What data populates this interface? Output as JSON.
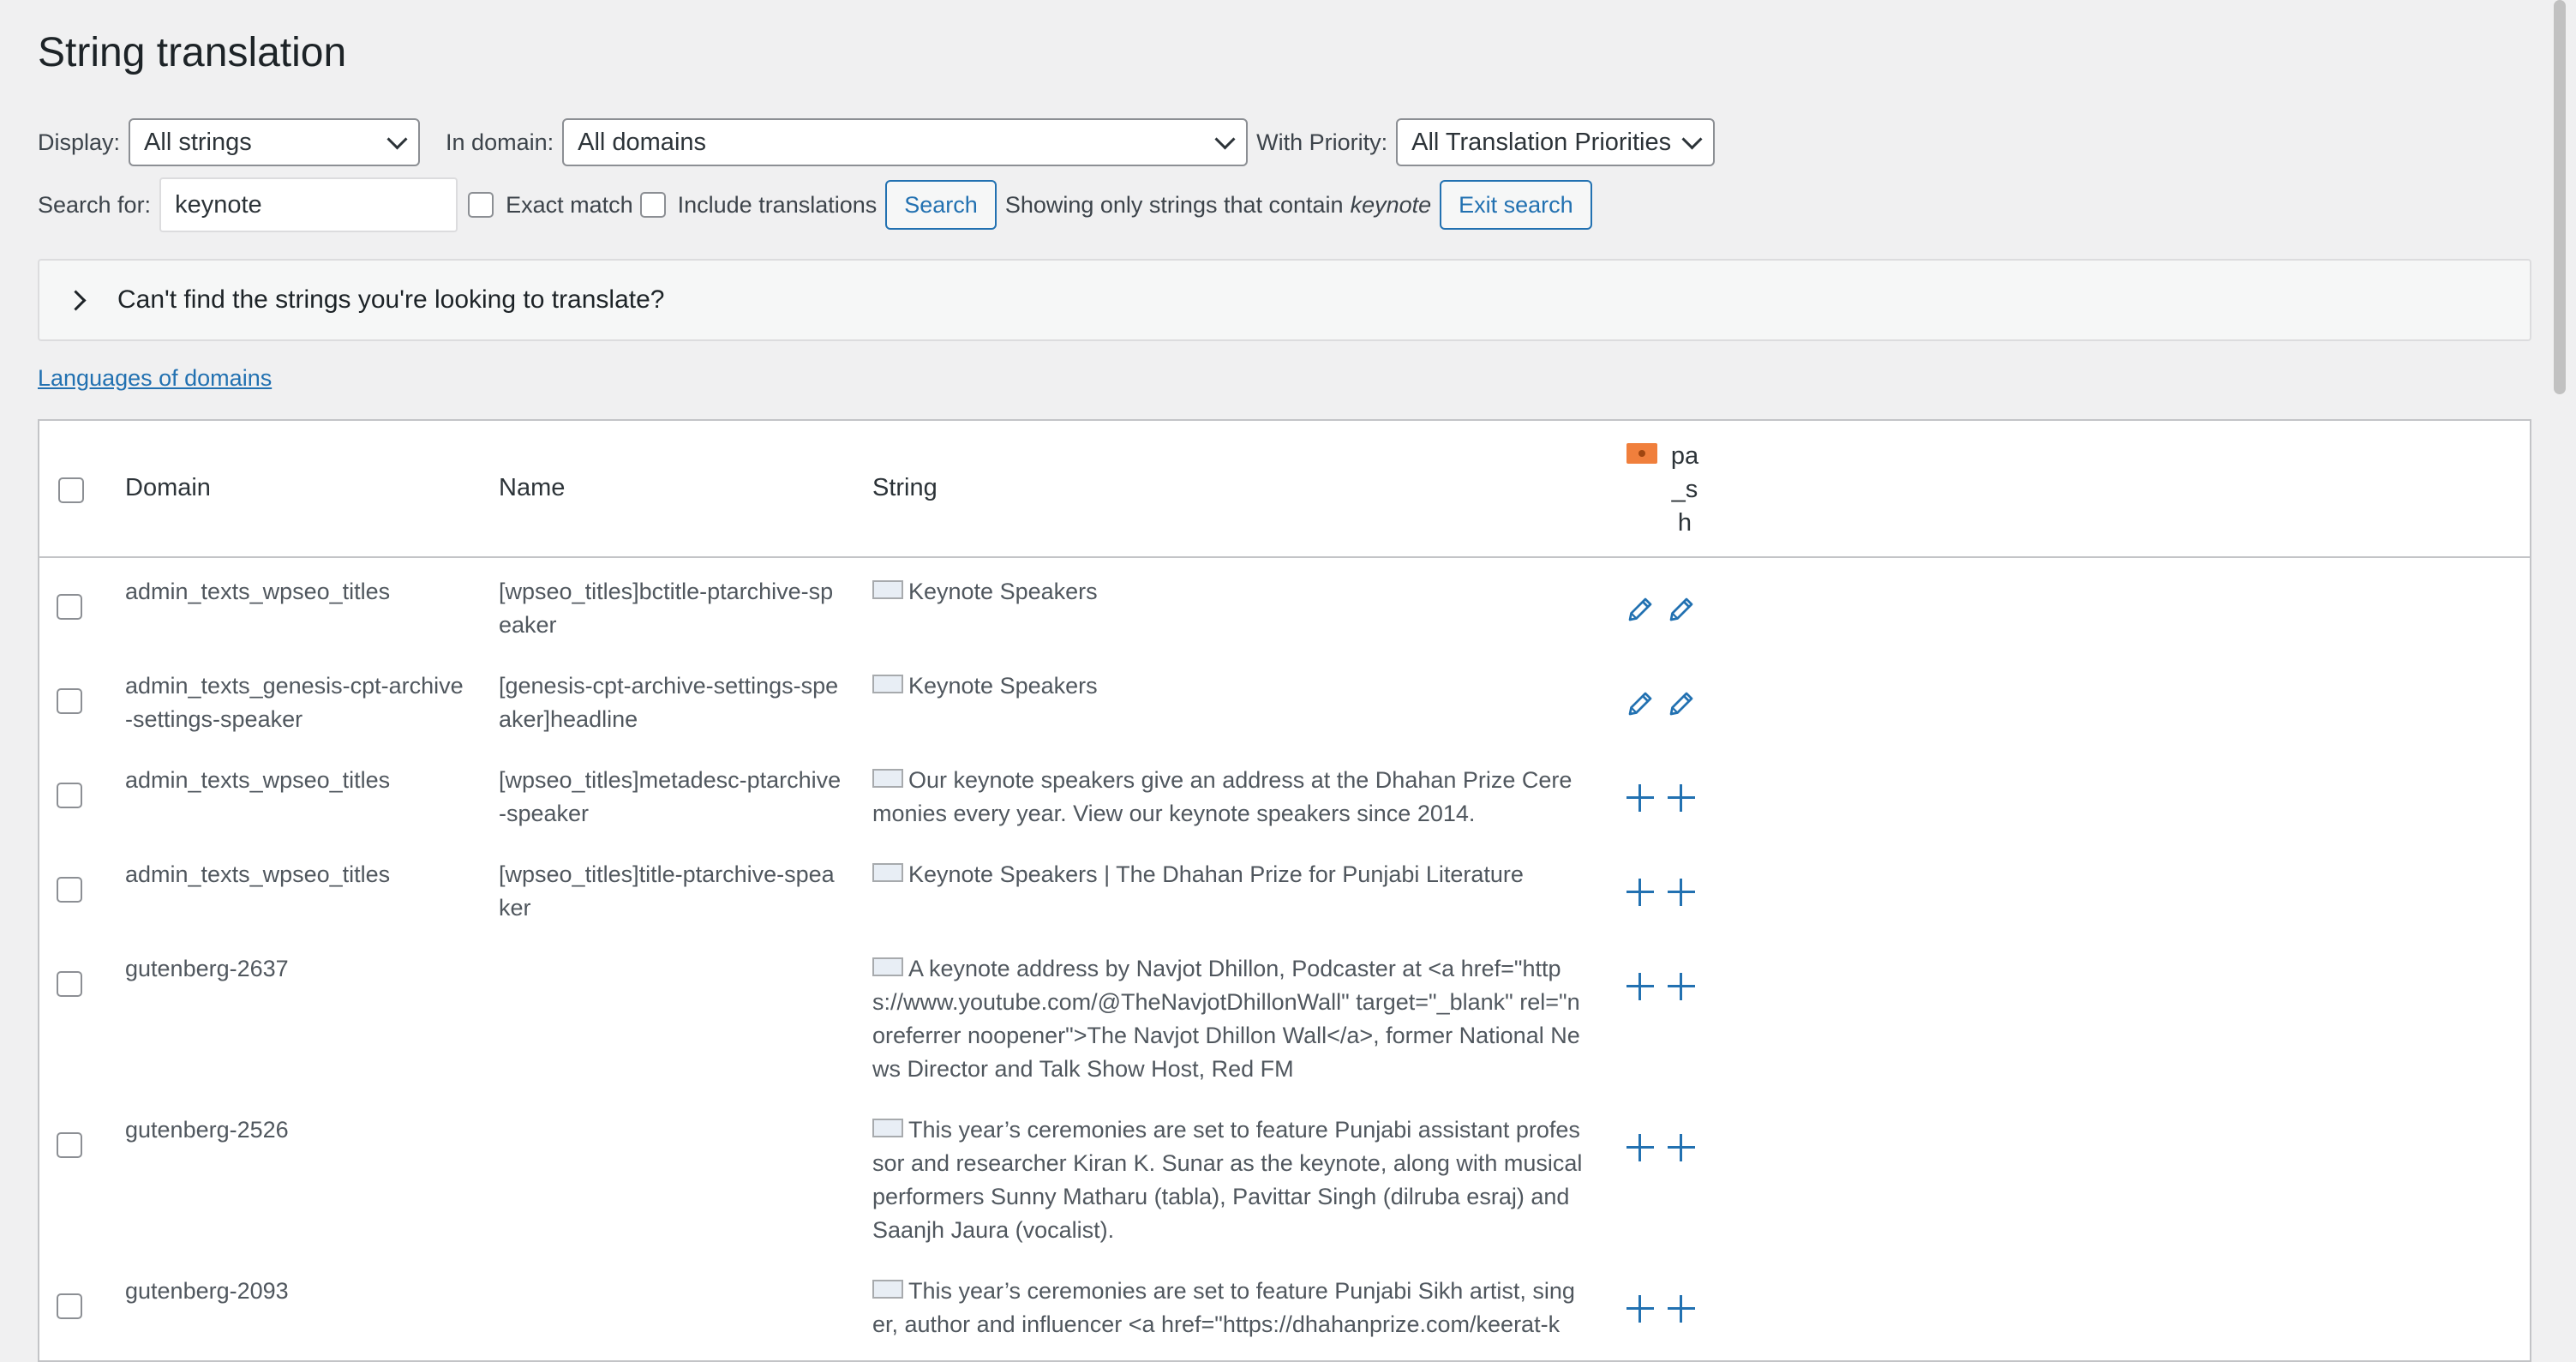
{
  "page_title": "String translation",
  "filters": {
    "display_label": "Display:",
    "display_value": "All strings",
    "domain_label": "In domain:",
    "domain_value": "All domains",
    "priority_label": "With Priority:",
    "priority_value": "All Translation Priorities"
  },
  "search": {
    "label": "Search for:",
    "value": "keynote",
    "exact_match": "Exact match",
    "include_translations": "Include translations",
    "search_button": "Search",
    "showing_prefix": "Showing only strings that contain",
    "showing_term": "keynote",
    "exit_button": "Exit search"
  },
  "notice": "Can't find the strings you're looking to translate?",
  "languages_link": "Languages of domains",
  "table": {
    "headers": {
      "domain": "Domain",
      "name": "Name",
      "string": "String",
      "lang": "pa_sh"
    },
    "rows": [
      {
        "domain": "admin_texts_wpseo_titles",
        "name": "[wpseo_titles]bctitle-ptarchive-speaker",
        "string": "Keynote Speakers",
        "actions": "edit"
      },
      {
        "domain": "admin_texts_genesis-cpt-archive-settings-speaker",
        "name": "[genesis-cpt-archive-settings-speaker]headline",
        "string": "Keynote Speakers",
        "actions": "edit"
      },
      {
        "domain": "admin_texts_wpseo_titles",
        "name": "[wpseo_titles]metadesc-ptarchive-speaker",
        "string": "Our keynote speakers give an address at the Dhahan Prize Ceremonies every year. View our keynote speakers since 2014.",
        "actions": "add"
      },
      {
        "domain": "admin_texts_wpseo_titles",
        "name": "[wpseo_titles]title-ptarchive-speaker",
        "string": "Keynote Speakers | The Dhahan Prize for Punjabi Literature",
        "actions": "add"
      },
      {
        "domain": "gutenberg-2637",
        "name": "",
        "string": "A keynote address by Navjot Dhillon, Podcaster at <a href=\"https://www.youtube.com/@TheNavjotDhillonWall\" target=\"_blank\" rel=\"noreferrer noopener\">The Navjot Dhillon Wall</a>, former National News Director and Talk Show Host, Red FM",
        "actions": "add"
      },
      {
        "domain": "gutenberg-2526",
        "name": "",
        "string": "This year’s ceremonies are set to feature Punjabi assistant professor and researcher Kiran K. Sunar as the keynote, along with musical performers Sunny Matharu (tabla), Pavittar Singh (dilruba esraj) and Saanjh Jaura (vocalist).",
        "actions": "add"
      },
      {
        "domain": "gutenberg-2093",
        "name": "",
        "string": "This year’s ceremonies are set to feature Punjabi Sikh artist, singer, author and influencer <a href=\"https://dhahanprize.com/keerat-k",
        "actions": "add"
      }
    ]
  }
}
